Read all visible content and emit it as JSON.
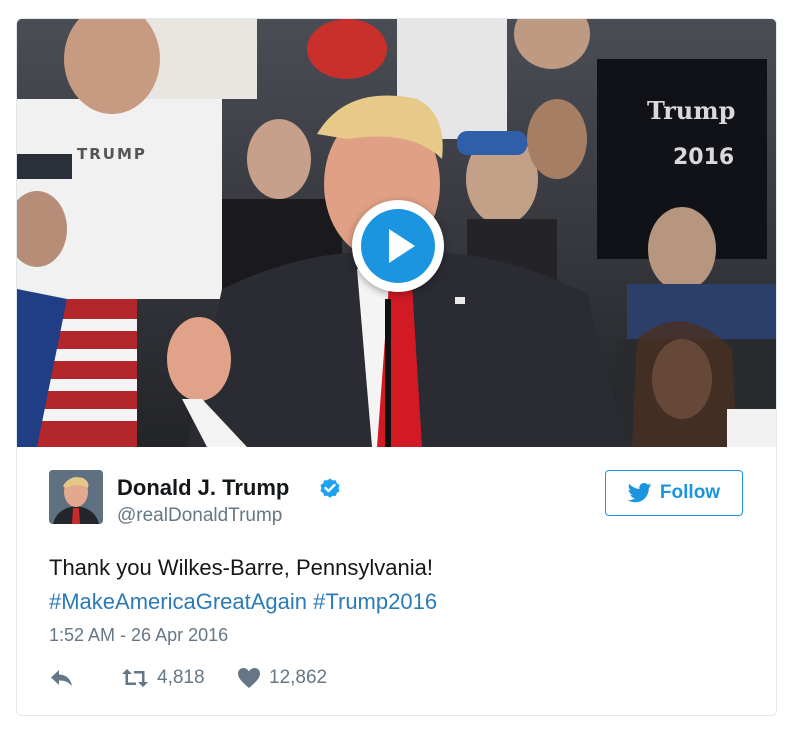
{
  "video": {
    "crowd_signs": {
      "shirt_left": "TRUMP",
      "shirt_right_top": "Trump",
      "shirt_right_year": "2016"
    }
  },
  "author": {
    "name": "Donald J. Trump",
    "handle": "@realDonaldTrump",
    "verified_icon": "verified-badge-icon",
    "avatar_icon": "profile-photo"
  },
  "follow": {
    "label": "Follow",
    "icon": "twitter-bird-icon"
  },
  "tweet": {
    "text": "Thank you Wilkes-Barre, Pennsylvania!",
    "hashtags": [
      "#MakeAmericaGreatAgain",
      "#Trump2016"
    ]
  },
  "timestamp": "1:52 AM - 26 Apr 2016",
  "actions": {
    "reply_icon": "reply-icon",
    "retweet_icon": "retweet-icon",
    "retweet_count": "4,818",
    "like_icon": "heart-icon",
    "like_count": "12,862"
  },
  "colors": {
    "accent": "#1b95e0",
    "hashtag": "#2b7bb9",
    "text": "#14171a",
    "muted": "#657786",
    "border": "#e1e8ed"
  }
}
